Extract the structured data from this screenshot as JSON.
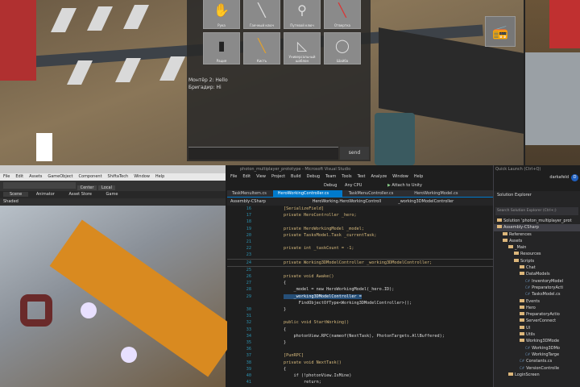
{
  "inventory": {
    "items": [
      {
        "label": "Рука",
        "icon": "hand-icon"
      },
      {
        "label": "Гаечный ключ",
        "icon": "wrench-icon"
      },
      {
        "label": "Путевой ключ",
        "icon": "key-icon"
      },
      {
        "label": "Отвертка",
        "icon": "screwdriver-icon"
      },
      {
        "label": "Рация",
        "icon": "radio-icon"
      },
      {
        "label": "Кисть",
        "icon": "brush-icon"
      },
      {
        "label": "Универсальный шаблон",
        "icon": "template-icon"
      },
      {
        "label": "Шайба",
        "icon": "washer-icon"
      }
    ],
    "chat": [
      "Монтёр 2: Hello",
      "Бригадир: Hi"
    ],
    "send_label": "send"
  },
  "unity": {
    "menu": [
      "File",
      "Edit",
      "Assets",
      "GameObject",
      "Component",
      "ShiftaTech",
      "Window",
      "Help"
    ],
    "pivot": "Center",
    "space": "Local",
    "tabs": [
      "Scene",
      "Animator",
      "Asset Store",
      "Game"
    ],
    "shaded": "Shaded"
  },
  "vs": {
    "title": "photon_multiplayer_prototype - Microsoft Visual Studio",
    "menu": [
      "File",
      "Edit",
      "View",
      "Project",
      "Build",
      "Debug",
      "Team",
      "Tools",
      "Test",
      "Analyze",
      "Window",
      "Help"
    ],
    "config": "Debug",
    "platform": "Any CPU",
    "attach": "Attach to Unity",
    "quick_launch": "Quick Launch (Ctrl+Q)",
    "user": "darkafeld",
    "avatar": "D",
    "tabs": [
      "TaskMenuItem.cs",
      "HeroWorkingController.cs",
      "TaskMenuController.cs",
      "HeroWorkingModel.cs"
    ],
    "nav": [
      "Assembly-CSharp",
      "HeroWorking.HeroWorkingControll",
      "_working3DModelController"
    ],
    "lines": [
      {
        "n": "16",
        "t": "[SerializeField]"
      },
      {
        "n": "17",
        "t": "private HeroController _hero;"
      },
      {
        "n": "18",
        "t": ""
      },
      {
        "n": "19",
        "t": "private HeroWorkingModel _model;"
      },
      {
        "n": "20",
        "t": "private TasksModel.Task _currentTask;"
      },
      {
        "n": "21",
        "t": ""
      },
      {
        "n": "22",
        "t": "private int _taskCount = -1;"
      },
      {
        "n": "23",
        "t": ""
      },
      {
        "n": "24",
        "t": "private Working3DModelController _working3DModelController;"
      },
      {
        "n": "25",
        "t": ""
      },
      {
        "n": "26",
        "t": "private void Awake()"
      },
      {
        "n": "27",
        "t": "{"
      },
      {
        "n": "28",
        "t": "    _model = new HeroWorkingModel(_hero.ID);"
      },
      {
        "n": "29",
        "t": "    _working3DModelController ="
      },
      {
        "n": "",
        "t": "      FindObjectOfType<Working3DModelController>();"
      },
      {
        "n": "30",
        "t": "}"
      },
      {
        "n": "31",
        "t": ""
      },
      {
        "n": "32",
        "t": "public void StartWorking()"
      },
      {
        "n": "33",
        "t": "{"
      },
      {
        "n": "34",
        "t": "    photonView.RPC(nameof(NextTask), PhotonTargets.AllBuffered);"
      },
      {
        "n": "35",
        "t": "}"
      },
      {
        "n": "36",
        "t": ""
      },
      {
        "n": "37",
        "t": "[PunRPC]"
      },
      {
        "n": "38",
        "t": "private void NextTask()"
      },
      {
        "n": "39",
        "t": "{"
      },
      {
        "n": "40",
        "t": "    if (!photonView.IsMine)"
      },
      {
        "n": "41",
        "t": "        return;"
      }
    ]
  },
  "solution": {
    "title": "Solution Explorer",
    "search": "Search Solution Explorer (Ctrl+;)",
    "items": [
      {
        "d": 0,
        "t": "Solution 'photon_multiplayer_prot",
        "k": "sln"
      },
      {
        "d": 0,
        "t": "Assembly-CSharp",
        "k": "proj"
      },
      {
        "d": 1,
        "t": "References",
        "k": "ref"
      },
      {
        "d": 1,
        "t": "Assets",
        "k": "f"
      },
      {
        "d": 2,
        "t": "_Main",
        "k": "f"
      },
      {
        "d": 3,
        "t": "Resources",
        "k": "f"
      },
      {
        "d": 3,
        "t": "Scripts",
        "k": "f"
      },
      {
        "d": 4,
        "t": "Chat",
        "k": "f"
      },
      {
        "d": 4,
        "t": "DataModels",
        "k": "f"
      },
      {
        "d": 5,
        "t": "InventoryModel",
        "k": "cs"
      },
      {
        "d": 5,
        "t": "PreparatoryActi",
        "k": "cs"
      },
      {
        "d": 5,
        "t": "TasksModel.cs",
        "k": "cs"
      },
      {
        "d": 4,
        "t": "Events",
        "k": "f"
      },
      {
        "d": 4,
        "t": "Hero",
        "k": "f"
      },
      {
        "d": 4,
        "t": "PreparatoryActio",
        "k": "f"
      },
      {
        "d": 4,
        "t": "ServerConnect",
        "k": "f"
      },
      {
        "d": 4,
        "t": "UI",
        "k": "f"
      },
      {
        "d": 4,
        "t": "Utils",
        "k": "f"
      },
      {
        "d": 4,
        "t": "Working3DMode",
        "k": "f"
      },
      {
        "d": 5,
        "t": "Working3DMo",
        "k": "cs"
      },
      {
        "d": 5,
        "t": "WorkingTarge",
        "k": "cs"
      },
      {
        "d": 4,
        "t": "Constants.cs",
        "k": "cs"
      },
      {
        "d": 4,
        "t": "VersionControlle",
        "k": "cs"
      },
      {
        "d": 2,
        "t": "LoginScreen",
        "k": "f"
      }
    ]
  }
}
